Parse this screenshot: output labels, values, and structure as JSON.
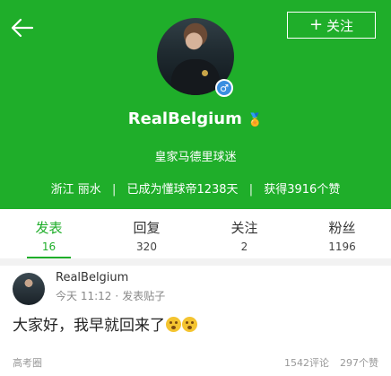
{
  "header": {
    "follow_label": "关注",
    "username": "RealBelgium",
    "fan_title": "皇家马德里球迷",
    "location": "浙江 丽水",
    "membership": "已成为懂球帝1238天",
    "likes": "获得3916个赞",
    "separator": "|",
    "accent_color": "#1fae2a"
  },
  "tabs": [
    {
      "label": "发表",
      "count": "16"
    },
    {
      "label": "回复",
      "count": "320"
    },
    {
      "label": "关注",
      "count": "2"
    },
    {
      "label": "粉丝",
      "count": "1196"
    }
  ],
  "post": {
    "username": "RealBelgium",
    "time": "今天 11:12",
    "action": "发表贴子",
    "meta_separator": "·",
    "text": "大家好，我早就回来了",
    "forum": "高考圈",
    "comments": "1542评论",
    "likes": "297个赞"
  }
}
